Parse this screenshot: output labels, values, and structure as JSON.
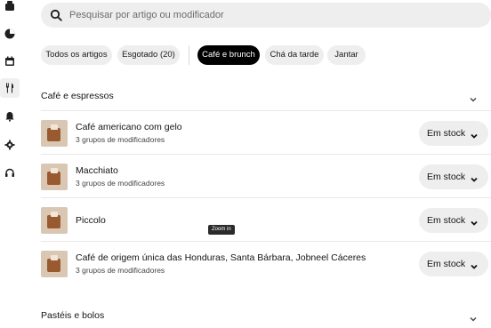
{
  "search": {
    "placeholder": "Pesquisar por artigo ou modificador"
  },
  "rail": {
    "icons": [
      "store-icon",
      "analytics-icon",
      "calendar-icon",
      "menu-icon",
      "notifications-icon",
      "settings-icon",
      "support-icon"
    ],
    "active": "menu-icon"
  },
  "chips": [
    {
      "label": "Todos os artigos",
      "active": false
    },
    {
      "label": "Esgotado (20)",
      "active": false
    },
    {
      "label": "Café e brunch",
      "active": true
    },
    {
      "label": "Chá da tarde",
      "active": false
    },
    {
      "label": "Jantar",
      "active": false
    }
  ],
  "sections": [
    {
      "title": "Café e espressos"
    },
    {
      "title": "Pastéis e bolos"
    }
  ],
  "items": [
    {
      "name": "Café americano com gelo",
      "modifiers": "3 grupos de modificadores",
      "status": "Em stock"
    },
    {
      "name": "Macchiato",
      "modifiers": "3 grupos de modificadores",
      "status": "Em stock"
    },
    {
      "name": "Piccolo",
      "modifiers": "",
      "status": "Em stock"
    },
    {
      "name": "Café de origem única das Honduras, Santa Bárbara, Jobneel Cáceres",
      "modifiers": "3 grupos de modificadores",
      "status": "Em stock"
    }
  ],
  "tooltip": "Zoom in",
  "colors": {
    "active_chip_bg": "#000000",
    "chip_bg": "#eeeeee",
    "pill_bg": "#eeeeee"
  }
}
